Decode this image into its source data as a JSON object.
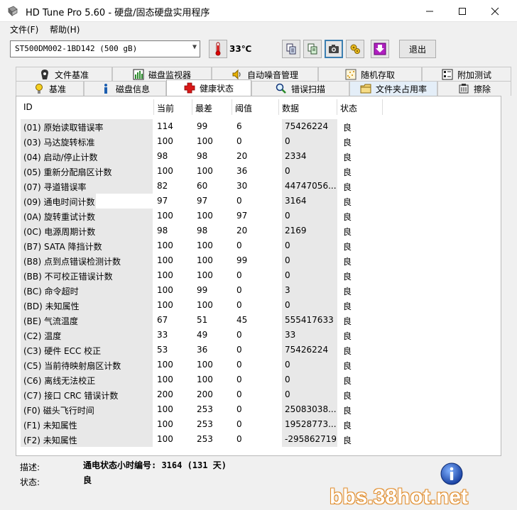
{
  "window": {
    "title": "HD Tune Pro 5.60 - 硬盘/固态硬盘实用程序"
  },
  "menu": {
    "file": "文件(F)",
    "help": "帮助(H)"
  },
  "toolbar": {
    "drive": "ST500DM002-1BD142 (500 gB)",
    "temperature": "33℃",
    "exit_label": "退出"
  },
  "tabs_row1": [
    {
      "label": "文件基准",
      "icon": "file-benchmark-icon"
    },
    {
      "label": "磁盘监视器",
      "icon": "disk-monitor-icon"
    },
    {
      "label": "自动噪音管理",
      "icon": "speaker-icon"
    },
    {
      "label": "随机存取",
      "icon": "random-access-icon"
    },
    {
      "label": "附加测试",
      "icon": "extra-tests-icon"
    }
  ],
  "tabs_row2": [
    {
      "label": "基准",
      "icon": "benchmark-icon"
    },
    {
      "label": "磁盘信息",
      "icon": "info-icon"
    },
    {
      "label": "健康状态",
      "icon": "health-cross-icon"
    },
    {
      "label": "错误扫描",
      "icon": "magnifier-icon"
    },
    {
      "label": "文件夹占用率",
      "icon": "folder-icon"
    },
    {
      "label": "擦除",
      "icon": "erase-icon"
    }
  ],
  "table": {
    "headers": [
      "ID",
      "当前",
      "最差",
      "阈值",
      "数据",
      "状态"
    ],
    "rows": [
      [
        "(01) 原始读取错误率",
        "114",
        "99",
        "6",
        "75426224",
        "良"
      ],
      [
        "(03) 马达旋转标准",
        "100",
        "100",
        "0",
        "0",
        "良"
      ],
      [
        "(04) 启动/停止计数",
        "98",
        "98",
        "20",
        "2334",
        "良"
      ],
      [
        "(05) 重新分配扇区计数",
        "100",
        "100",
        "36",
        "0",
        "良"
      ],
      [
        "(07) 寻道错误率",
        "82",
        "60",
        "30",
        "44747056...",
        "良"
      ],
      [
        "(09) 通电时间计数",
        "97",
        "97",
        "0",
        "3164",
        "良"
      ],
      [
        "(0A) 旋转重试计数",
        "100",
        "100",
        "97",
        "0",
        "良"
      ],
      [
        "(0C) 电源周期计数",
        "98",
        "98",
        "20",
        "2169",
        "良"
      ],
      [
        "(B7) SATA 降挡计数",
        "100",
        "100",
        "0",
        "0",
        "良"
      ],
      [
        "(B8) 点到点错误检测计数",
        "100",
        "100",
        "99",
        "0",
        "良"
      ],
      [
        "(BB) 不可校正错误计数",
        "100",
        "100",
        "0",
        "0",
        "良"
      ],
      [
        "(BC) 命令超时",
        "100",
        "99",
        "0",
        "3",
        "良"
      ],
      [
        "(BD) 未知属性",
        "100",
        "100",
        "0",
        "0",
        "良"
      ],
      [
        "(BE) 气流温度",
        "67",
        "51",
        "45",
        "555417633",
        "良"
      ],
      [
        "(C2) 温度",
        "33",
        "49",
        "0",
        "33",
        "良"
      ],
      [
        "(C3) 硬件 ECC 校正",
        "53",
        "36",
        "0",
        "75426224",
        "良"
      ],
      [
        "(C5) 当前待映射扇区计数",
        "100",
        "100",
        "0",
        "0",
        "良"
      ],
      [
        "(C6) 离线无法校正",
        "100",
        "100",
        "0",
        "0",
        "良"
      ],
      [
        "(C7) 接口 CRC 错误计数",
        "200",
        "200",
        "0",
        "0",
        "良"
      ],
      [
        "(F0) 磁头飞行时间",
        "100",
        "253",
        "0",
        "25083038...",
        "良"
      ],
      [
        "(F1) 未知属性",
        "100",
        "253",
        "0",
        "19528773...",
        "良"
      ],
      [
        "(F2) 未知属性",
        "100",
        "253",
        "0",
        "-295862719",
        "良"
      ]
    ],
    "selected_row": 5
  },
  "details": {
    "desc_label": "描述:",
    "desc_value": "通电状态小时编号: 3164 (131 天)",
    "status_label": "状态:",
    "status_value": "良"
  },
  "watermark": "bbs.38hot.net"
}
